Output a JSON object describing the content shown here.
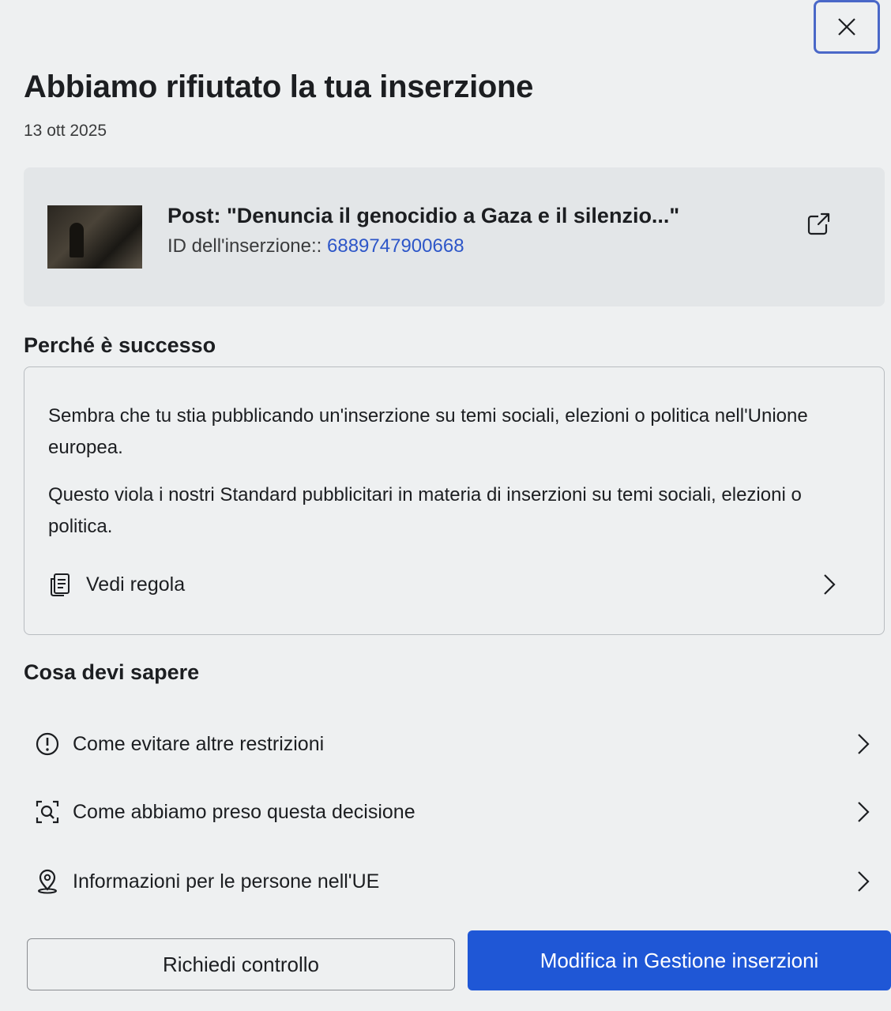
{
  "dialog": {
    "title": "Abbiamo rifiutato la tua inserzione",
    "date": "13 ott 2025",
    "close_icon": "close-icon"
  },
  "ad": {
    "post_title": "Post: \"Denuncia il genocidio a Gaza e il silenzio...\"",
    "id_label": "ID dell'inserzione::",
    "id_value": "6889747900668",
    "external_icon": "open-external-icon"
  },
  "why": {
    "heading": "Perché è successo",
    "paragraph1": "Sembra che tu stia pubblicando un'inserzione su temi sociali, elezioni o politica nell'Unione europea.",
    "paragraph2": "Questo viola i nostri Standard pubblicitari in materia di inserzioni su temi sociali, elezioni o politica.",
    "rule_link": "Vedi regola",
    "rule_icon": "document-icon"
  },
  "know": {
    "heading": "Cosa devi sapere",
    "items": [
      {
        "label": "Come evitare altre restrizioni",
        "icon": "alert-circle-icon"
      },
      {
        "label": "Come abbiamo preso questa decisione",
        "icon": "search-scan-icon"
      },
      {
        "label": "Informazioni per le persone nell'UE",
        "icon": "location-pin-icon"
      }
    ]
  },
  "actions": {
    "secondary": "Richiedi controllo",
    "primary": "Modifica in Gestione inserzioni"
  },
  "colors": {
    "primary": "#1f57d6",
    "link": "#2d56c8"
  }
}
